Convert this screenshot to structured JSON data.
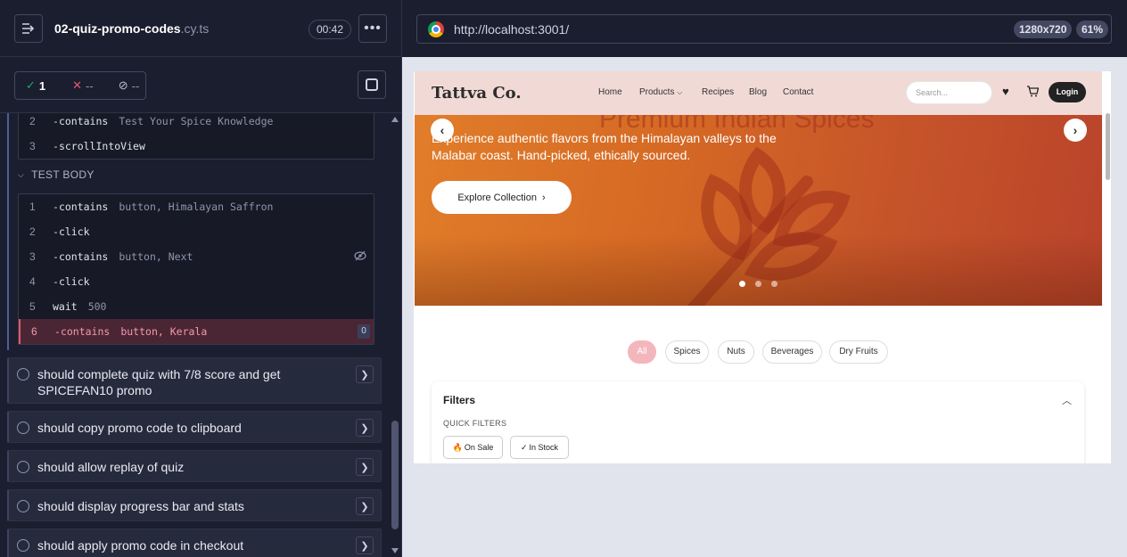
{
  "reporter": {
    "spec_file": "02-quiz-promo-codes",
    "spec_ext": ".cy.ts",
    "timer": "00:42",
    "stats": {
      "passed": "1",
      "failed": "--",
      "pending": "--"
    },
    "prior_commands": [
      {
        "line": "2",
        "name": "contains",
        "arg": "Test Your Spice Knowledge"
      },
      {
        "line": "3",
        "name": "scrollIntoView",
        "arg": ""
      }
    ],
    "test_body_label": "TEST BODY",
    "body_commands": [
      {
        "line": "1",
        "name": "contains",
        "arg": "button, Himalayan Saffron",
        "dash": "-"
      },
      {
        "line": "2",
        "name": "click",
        "arg": "",
        "dash": "-"
      },
      {
        "line": "3",
        "name": "contains",
        "arg": "button, Next",
        "dash": "-"
      },
      {
        "line": "4",
        "name": "click",
        "arg": "",
        "dash": "-"
      },
      {
        "line": "5",
        "name": "wait",
        "arg": "500",
        "dash": ""
      },
      {
        "line": "6",
        "name": "contains",
        "arg": "button, Kerala",
        "dash": "-",
        "badge": "0"
      }
    ],
    "tests": [
      {
        "title": "should complete quiz with 7/8 score and get SPICEFAN10 promo"
      },
      {
        "title": "should copy promo code to clipboard"
      },
      {
        "title": "should allow replay of quiz"
      },
      {
        "title": "should display progress bar and stats"
      },
      {
        "title": "should apply promo code in checkout"
      }
    ]
  },
  "browser": {
    "url": "http://localhost:3001/",
    "viewport": "1280x720",
    "zoom": "61%"
  },
  "site": {
    "logo": "Tattva Co.",
    "nav": [
      "Home",
      "Products",
      "Recipes",
      "Blog",
      "Contact"
    ],
    "search_placeholder": "Search...",
    "login": "Login",
    "hero_ghost_title": "Premium Indian Spices",
    "hero_subtitle": "Experience authentic flavors from the Himalayan valleys to the Malabar coast. Hand-picked, ethically sourced.",
    "cta": "Explore Collection",
    "categories": [
      "All",
      "Spices",
      "Nuts",
      "Beverages",
      "Dry Fruits"
    ],
    "filters_title": "Filters",
    "quick_filters_label": "QUICK FILTERS",
    "quick_filters": [
      "On Sale",
      "In Stock"
    ]
  },
  "colors": {
    "accent_fail": "#e45770",
    "accent_pass": "#1fa971",
    "hero_orange": "#d66a24",
    "pill_active": "#f4b6bd"
  }
}
